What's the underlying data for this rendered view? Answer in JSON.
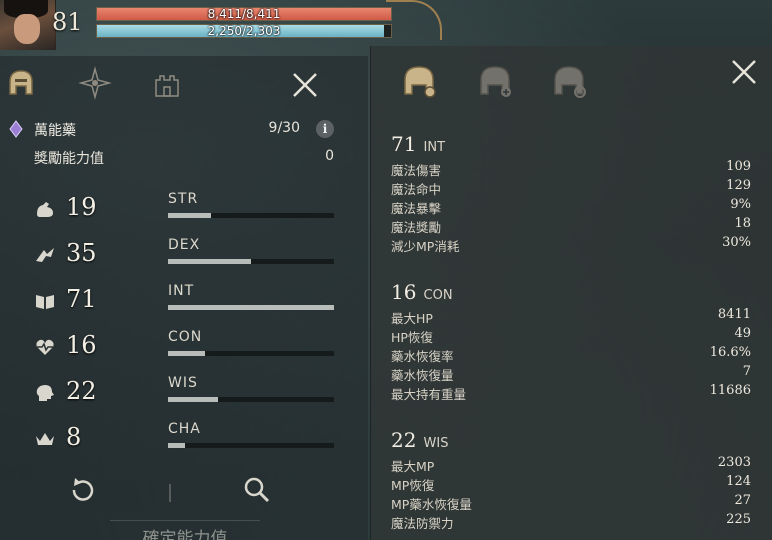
{
  "hud": {
    "level": "81",
    "hp_text": "8,411/8,411",
    "hp_fraction": 1.0,
    "mp_text": "2,250/2,303",
    "mp_fraction": 0.977,
    "hp_color": "#d8634f",
    "mp_color": "#8ccad8"
  },
  "left": {
    "tab_icons": [
      "helmet-tab-icon",
      "star-burst-tab-icon",
      "castle-tab-icon"
    ],
    "close_icon": "close-icon",
    "potion": {
      "icon": "purple-potion-icon",
      "label": "萬能藥",
      "count": "9/30",
      "info_symbol": "i"
    },
    "bonus": {
      "label": "獎勵能力值",
      "value": "0"
    },
    "stats": [
      {
        "icon": "str-arm-icon",
        "value": "19",
        "name": "STR",
        "fraction": 0.26
      },
      {
        "icon": "dex-wing-icon",
        "value": "35",
        "name": "DEX",
        "fraction": 0.5
      },
      {
        "icon": "int-book-icon",
        "value": "71",
        "name": "INT",
        "fraction": 1.0
      },
      {
        "icon": "con-heart-icon",
        "value": "16",
        "name": "CON",
        "fraction": 0.22
      },
      {
        "icon": "wis-head-icon",
        "value": "22",
        "name": "WIS",
        "fraction": 0.3
      },
      {
        "icon": "cha-crown-icon",
        "value": "8",
        "name": "CHA",
        "fraction": 0.1
      }
    ],
    "bottom_icons": [
      "reset-icon",
      "magnifier-icon"
    ],
    "confirm_label": "確定能力值"
  },
  "right": {
    "tab_icons": [
      "helmet-gear-tab-icon",
      "helmet-plus-tab-icon",
      "helmet-settings-tab-icon"
    ],
    "close_icon": "close-icon",
    "sections": [
      {
        "value": "71",
        "attr": "INT",
        "rows": [
          {
            "label": "魔法傷害",
            "value": "109"
          },
          {
            "label": "魔法命中",
            "value": "129"
          },
          {
            "label": "魔法暴擊",
            "value": "9%"
          },
          {
            "label": "魔法獎勵",
            "value": "18"
          },
          {
            "label": "減少MP消耗",
            "value": "30%"
          }
        ]
      },
      {
        "value": "16",
        "attr": "CON",
        "rows": [
          {
            "label": "最大HP",
            "value": "8411"
          },
          {
            "label": "HP恢復",
            "value": "49"
          },
          {
            "label": "藥水恢復率",
            "value": "16.6%"
          },
          {
            "label": "藥水恢復量",
            "value": "7"
          },
          {
            "label": "最大持有重量",
            "value": "11686"
          }
        ]
      },
      {
        "value": "22",
        "attr": "WIS",
        "rows": [
          {
            "label": "最大MP",
            "value": "2303"
          },
          {
            "label": "MP恢復",
            "value": "124"
          },
          {
            "label": "MP藥水恢復量",
            "value": "27"
          },
          {
            "label": "魔法防禦力",
            "value": "225"
          }
        ]
      }
    ]
  }
}
